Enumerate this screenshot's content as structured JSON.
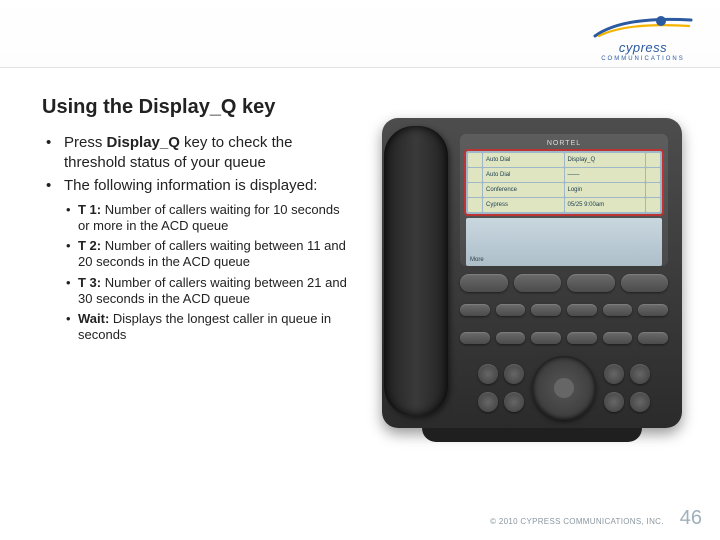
{
  "logo": {
    "word": "cypress",
    "sub": "COMMUNICATIONS"
  },
  "title": "Using the Display_Q key",
  "bullets": {
    "b1_pre": "Press ",
    "b1_bold": "Display_Q",
    "b1_post": " key to check the threshold status of your queue",
    "b2": "The following information is displayed:"
  },
  "sub_bullets": {
    "s1_bold": "T 1:",
    "s1_rest": "  Number of callers waiting for 10 seconds or more in the ACD queue",
    "s2_bold": "T 2:",
    "s2_rest": "  Number of callers waiting between 11 and 20 seconds in the ACD queue",
    "s3_bold": "T 3:",
    "s3_rest": "  Number of callers waiting between 21 and 30 seconds in the ACD queue",
    "s4_bold": "Wait:",
    "s4_rest": "  Displays the longest caller in queue in seconds"
  },
  "phone": {
    "brand": "NORTEL",
    "softkeys": {
      "r1c1": "Auto Dial",
      "r1c2": "Display_Q",
      "r2c1": "Auto Dial",
      "r2c2": "——",
      "r3c1": "Conference",
      "r3c2": "Login",
      "r4c1": "Cypress",
      "r4c2": "05/25  9:00am"
    },
    "lcd": {
      "topL": "",
      "topR": "",
      "soft1": "More"
    }
  },
  "footer": {
    "copyright": "© 2010 CYPRESS COMMUNICATIONS, INC.",
    "page": "46"
  }
}
